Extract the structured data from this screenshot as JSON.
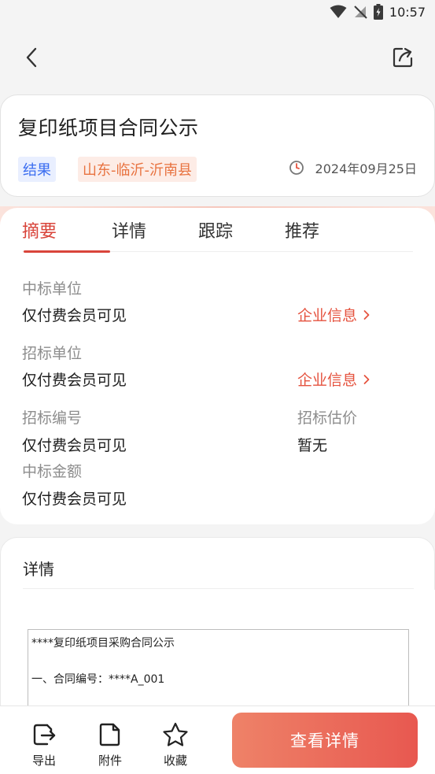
{
  "status_bar": {
    "time": "10:57"
  },
  "header": {
    "back_icon": "chevron-left-icon",
    "share_icon": "share-icon"
  },
  "title_card": {
    "title": "复印纸项目合同公示",
    "tag_type": "结果",
    "tag_region": "山东-临沂-沂南县",
    "date": "2024年09月25日"
  },
  "tabs": [
    {
      "label": "摘要",
      "active": true
    },
    {
      "label": "详情",
      "active": false
    },
    {
      "label": "跟踪",
      "active": false
    },
    {
      "label": "推荐",
      "active": false
    }
  ],
  "summary": {
    "winner_label": "中标单位",
    "winner_value": "仅付费会员可见",
    "winner_link": "企业信息",
    "tenderer_label": "招标单位",
    "tenderer_value": "仅付费会员可见",
    "tenderer_link": "企业信息",
    "bid_no_label": "招标编号",
    "bid_no_value": "仅付费会员可见",
    "estimate_label": "招标估价",
    "estimate_value": "暂无",
    "amount_label": "中标金额",
    "amount_value": "仅付费会员可见"
  },
  "detail": {
    "title": "详情",
    "doc_line_1": "****复印纸项目采购合同公示",
    "doc_line_2": "一、合同编号：****A_001"
  },
  "bottom_bar": {
    "export_label": "导出",
    "attachment_label": "附件",
    "favorite_label": "收藏",
    "cta_label": "查看详情"
  },
  "colors": {
    "accent_red": "#d9453b",
    "link_red": "#e5533f",
    "tag_blue": "#3a6df0",
    "tag_orange": "#e8723f",
    "cta_start": "#ee8268",
    "cta_end": "#e85850"
  }
}
